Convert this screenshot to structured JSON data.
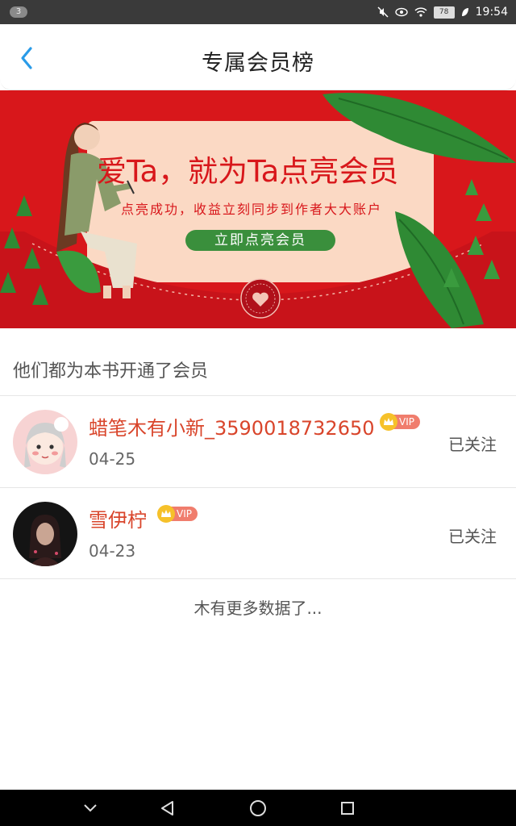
{
  "status_bar": {
    "notification_count": "3",
    "battery": "78",
    "time": "19:54",
    "icons": [
      "mute-icon",
      "eye-icon",
      "wifi-icon",
      "battery-icon",
      "leaf-icon"
    ]
  },
  "header": {
    "title": "专属会员榜",
    "back_icon": "chevron-left-icon",
    "accent_color": "#2a9be8"
  },
  "banner": {
    "headline": "爱Ta，就为Ta点亮会员",
    "subline": "点亮成功，收益立刻同步到作者大大账户",
    "button_label": "立即点亮会员",
    "colors": {
      "red": "#d8171b",
      "card": "#fbd9c4",
      "green": "#3a8f3c"
    }
  },
  "section": {
    "title": "他们都为本书开通了会员"
  },
  "members": [
    {
      "name": "蜡笔木有小新_3590018732650",
      "vip_label": "VIP",
      "date": "04-25",
      "follow_label": "已关注"
    },
    {
      "name": "雪伊柠",
      "vip_label": "VIP",
      "date": "04-23",
      "follow_label": "已关注"
    }
  ],
  "footer_text": "木有更多数据了...",
  "nav_bar": {
    "icons": [
      "chevron-down-icon",
      "back-triangle-icon",
      "home-circle-icon",
      "recents-square-icon"
    ]
  }
}
